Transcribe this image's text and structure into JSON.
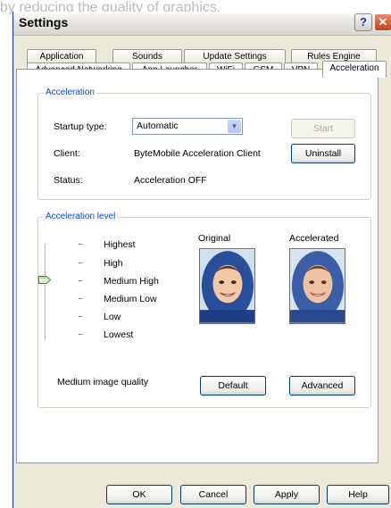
{
  "ghost_text": "by reducing the quality of graphics.",
  "window": {
    "title": "Settings"
  },
  "tabs": {
    "row1": [
      "Application",
      "Sounds",
      "Update Settings",
      "Rules Engine"
    ],
    "row2": [
      "Advanced Networking",
      "App Launcher",
      "WiFi",
      "GSM",
      "VPN",
      "Acceleration"
    ],
    "active": "Acceleration"
  },
  "acceleration_group": {
    "legend": "Acceleration",
    "startup_label": "Startup type:",
    "startup_value": "Automatic",
    "start_label": "Start",
    "client_label": "Client:",
    "client_value": "ByteMobile Acceleration Client",
    "uninstall_label": "Uninstall",
    "status_label": "Status:",
    "status_value": "Acceleration OFF"
  },
  "level_group": {
    "legend": "Acceleration level",
    "levels": [
      "Highest",
      "High",
      "Medium High",
      "Medium Low",
      "Low",
      "Lowest"
    ],
    "selected_level": "Medium High",
    "original_label": "Original",
    "accelerated_label": "Accelerated",
    "quality_label": "Medium image quality",
    "default_label": "Default",
    "advanced_label": "Advanced"
  },
  "footer": {
    "ok": "OK",
    "cancel": "Cancel",
    "apply": "Apply",
    "help": "Help"
  },
  "colors": {
    "accent": "#0046d5",
    "window_bg": "#ece9d8",
    "titlebar_border": "#0831d9",
    "close": "#c6401d"
  }
}
